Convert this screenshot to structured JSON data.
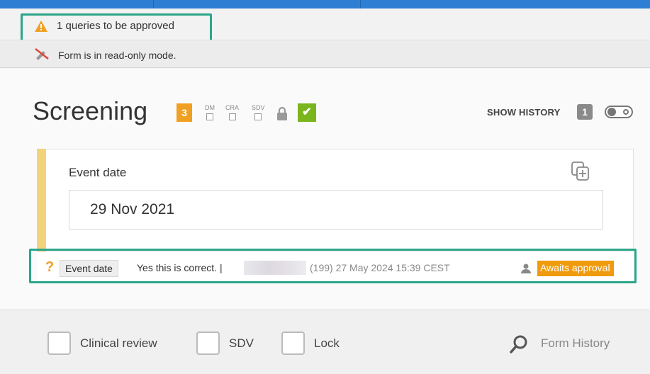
{
  "notices": {
    "queries_text": "1 queries to be approved",
    "readonly_text": "Form is in read-only mode."
  },
  "form": {
    "title": "Screening",
    "query_count": "3",
    "flags": [
      {
        "label": "DM"
      },
      {
        "label": "CRA"
      },
      {
        "label": "SDV"
      }
    ],
    "show_history_label": "SHOW HISTORY",
    "history_count": "1",
    "history_toggle": "off"
  },
  "field": {
    "label": "Event date",
    "value": "29 Nov 2021"
  },
  "query": {
    "tag": "Event date",
    "message": "Yes this is correct. |",
    "meta": "(199) 27 May 2024 15:39 CEST",
    "status": "Awaits approval"
  },
  "footer": {
    "checkboxes": [
      {
        "label": "Clinical review",
        "checked": false
      },
      {
        "label": "SDV",
        "checked": false
      },
      {
        "label": "Lock",
        "checked": false
      }
    ],
    "form_history_label": "Form History"
  },
  "colors": {
    "accent_blue": "#2e7fd3",
    "warning_orange": "#f0a023",
    "approved_green": "#7ab51d",
    "highlight_teal": "#2ba58a",
    "field_stripe": "#f1d37b"
  },
  "icons": [
    "warning-icon",
    "readonly-icon",
    "lock-icon",
    "check-icon",
    "copy-add-icon",
    "question-icon",
    "user-icon",
    "search-icon"
  ]
}
